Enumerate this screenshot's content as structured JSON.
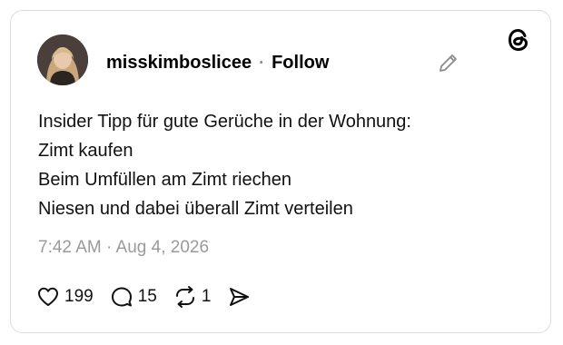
{
  "post": {
    "username": "misskimboslicee",
    "separator": "·",
    "follow_label": "Follow",
    "lines": [
      "Insider Tipp für gute Gerüche in der Wohnung:",
      "Zimt kaufen",
      "Beim Umfüllen am Zimt riechen",
      "Niesen und dabei überall Zimt verteilen"
    ],
    "timestamp": "7:42 AM · Aug 4, 2026"
  },
  "actions": {
    "likes": "199",
    "replies": "15",
    "reposts": "1"
  },
  "icons": {
    "brand": "threads-logo-icon",
    "edit": "pencil-icon",
    "like": "heart-icon",
    "reply": "comment-icon",
    "repost": "repost-icon",
    "share": "send-icon"
  }
}
